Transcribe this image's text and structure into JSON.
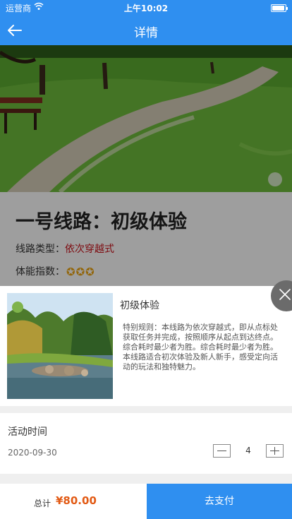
{
  "status_bar": {
    "carrier": "运营商",
    "time": "上午10:02",
    "battery_level": 0.95
  },
  "nav": {
    "title": "详情",
    "back_icon": "arrow-left-icon"
  },
  "route": {
    "name": "一号线路：初级体验",
    "type_label": "线路类型：",
    "type_value": "依次穿越式",
    "fitness_label": "体能指数：",
    "fitness_stars": 3,
    "star_glyph": "✪"
  },
  "product": {
    "title": "初级体验",
    "description": "特别规则：本线路为依次穿越式，即从点标处获取任务并完成，按照顺序从起点到达终点。综合耗时最少者为胜。综合耗时最少者为胜。\n本线路适合初次体验及新人新手，感受定向活动的玩法和独特魅力。"
  },
  "activity": {
    "label": "活动时间",
    "date": "2020-09-30",
    "quantity": "4"
  },
  "checkout": {
    "total_label": "总计",
    "total_price": "¥80.00",
    "pay_label": "去支付"
  },
  "colors": {
    "primary": "#2f8ff0",
    "price": "#e25a14",
    "type_value": "#c6131c",
    "star": "#e5a013"
  }
}
